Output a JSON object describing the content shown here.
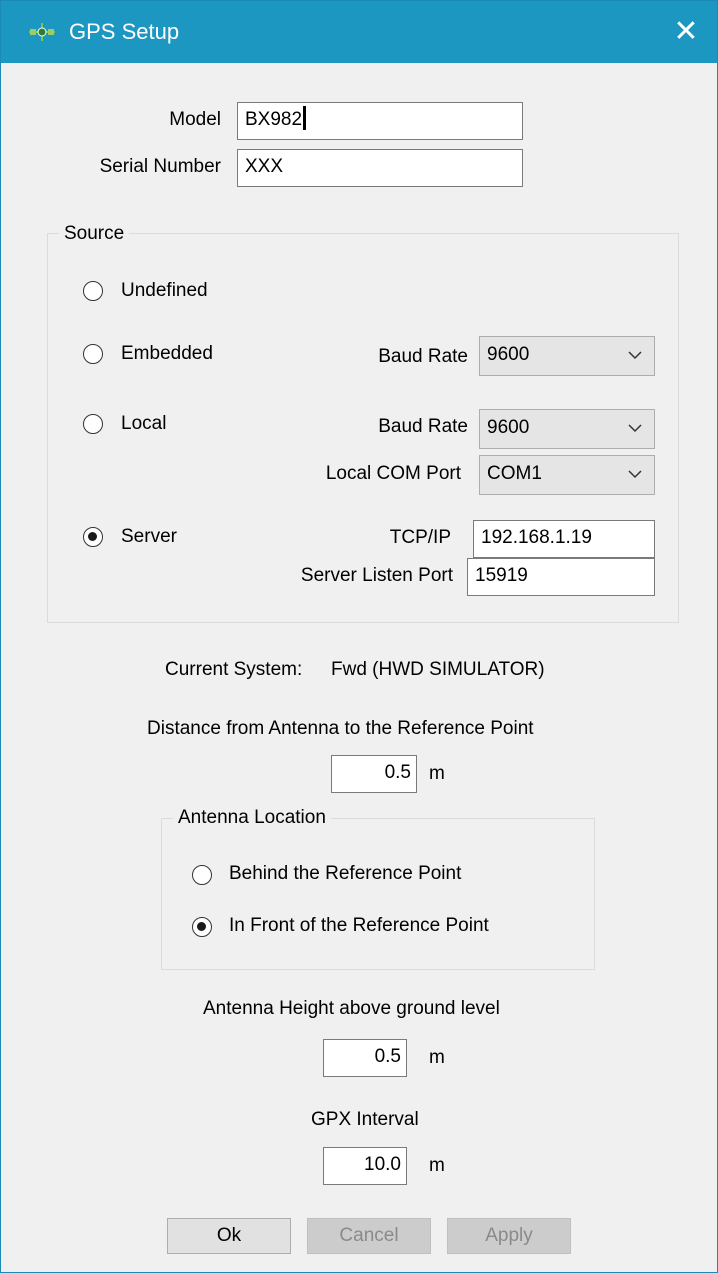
{
  "window": {
    "title": "GPS Setup",
    "close_glyph": "✕"
  },
  "model": {
    "label": "Model",
    "value": "BX982"
  },
  "serial": {
    "label": "Serial Number",
    "value": "XXX"
  },
  "source": {
    "title": "Source",
    "selected": "server",
    "options": {
      "undefined": "Undefined",
      "embedded": "Embedded",
      "local": "Local",
      "server": "Server"
    },
    "embedded_baud": {
      "label": "Baud Rate",
      "value": "9600"
    },
    "local_baud": {
      "label": "Baud Rate",
      "value": "9600"
    },
    "local_com": {
      "label": "Local COM Port",
      "value": "COM1"
    },
    "tcpip": {
      "label": "TCP/IP",
      "value": "192.168.1.19"
    },
    "server_port": {
      "label": "Server Listen Port",
      "value": "15919"
    }
  },
  "current_system": {
    "label": "Current System:",
    "value": "Fwd (HWD SIMULATOR)"
  },
  "distance": {
    "label": "Distance from Antenna to the Reference Point",
    "value": "0.5",
    "unit": "m"
  },
  "antenna_location": {
    "title": "Antenna Location",
    "selected": "front",
    "behind": "Behind the Reference Point",
    "front": "In Front of the Reference Point"
  },
  "height": {
    "label": "Antenna Height above ground level",
    "value": "0.5",
    "unit": "m"
  },
  "gpx": {
    "label": "GPX Interval",
    "value": "10.0",
    "unit": "m"
  },
  "buttons": {
    "ok": "Ok",
    "cancel": "Cancel",
    "apply": "Apply"
  },
  "icons": {
    "app": "gps-satellite-icon",
    "close": "close-icon",
    "dropdown": "chevron-down-icon"
  },
  "colors": {
    "titlebar": "#1b97c2",
    "window_bg": "#f0f0f0"
  }
}
